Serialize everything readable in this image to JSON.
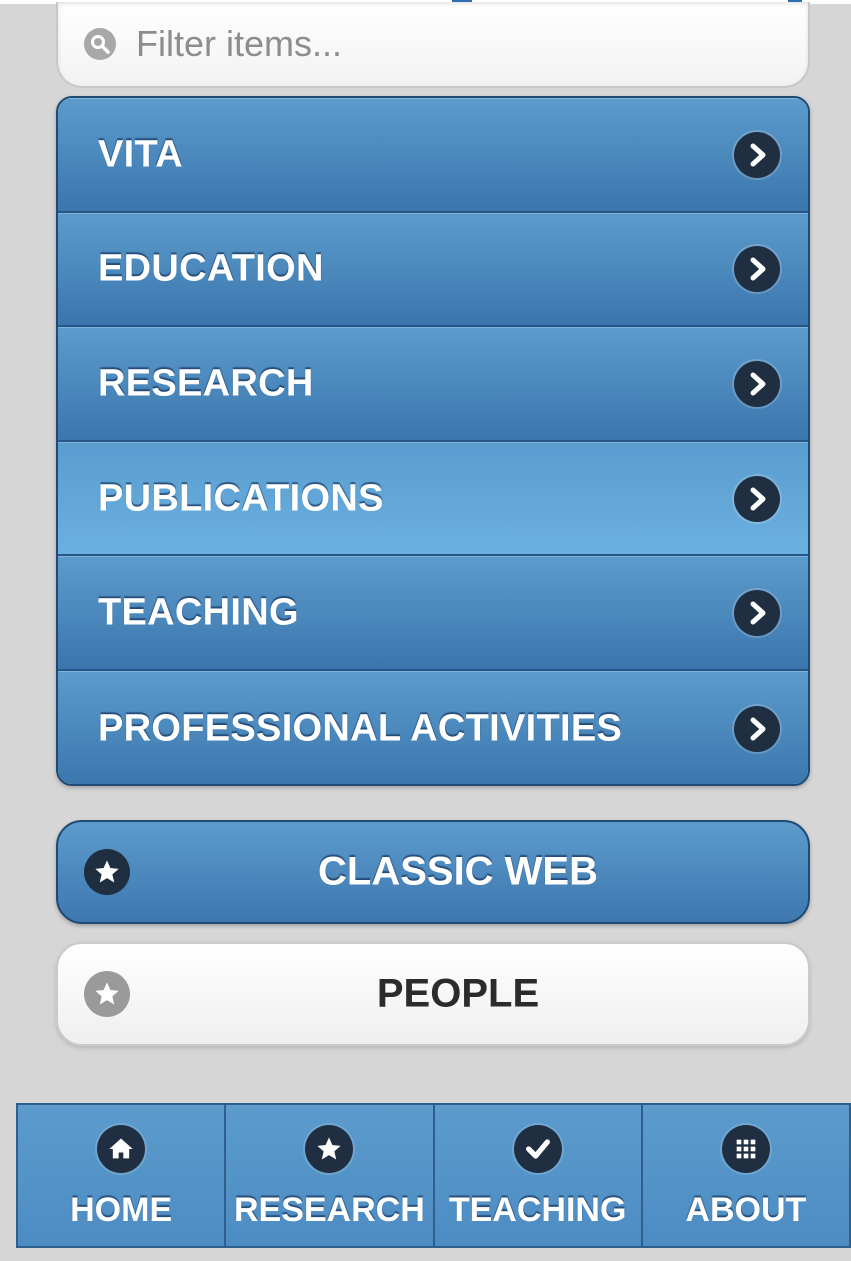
{
  "search": {
    "placeholder": "Filter items..."
  },
  "list": {
    "items": [
      {
        "label": "VITA",
        "active": false
      },
      {
        "label": "EDUCATION",
        "active": false
      },
      {
        "label": "RESEARCH",
        "active": false
      },
      {
        "label": "PUBLICATIONS",
        "active": true
      },
      {
        "label": "TEACHING",
        "active": false
      },
      {
        "label": "PROFESSIONAL ACTIVITIES",
        "active": false
      }
    ]
  },
  "buttons": {
    "classic_web": {
      "label": "CLASSIC WEB",
      "icon": "star-icon"
    },
    "people": {
      "label": "PEOPLE",
      "icon": "star-icon"
    }
  },
  "navbar": {
    "items": [
      {
        "label": "HOME",
        "icon": "home-icon"
      },
      {
        "label": "RESEARCH",
        "icon": "star-icon"
      },
      {
        "label": "TEACHING",
        "icon": "check-icon"
      },
      {
        "label": "ABOUT",
        "icon": "grid-icon"
      }
    ]
  },
  "colors": {
    "bar_blue": "#3b76ad",
    "bar_blue_light": "#5c9bcc",
    "page_bg": "#d6d6d6",
    "icon_dark": "#1f2e40"
  }
}
